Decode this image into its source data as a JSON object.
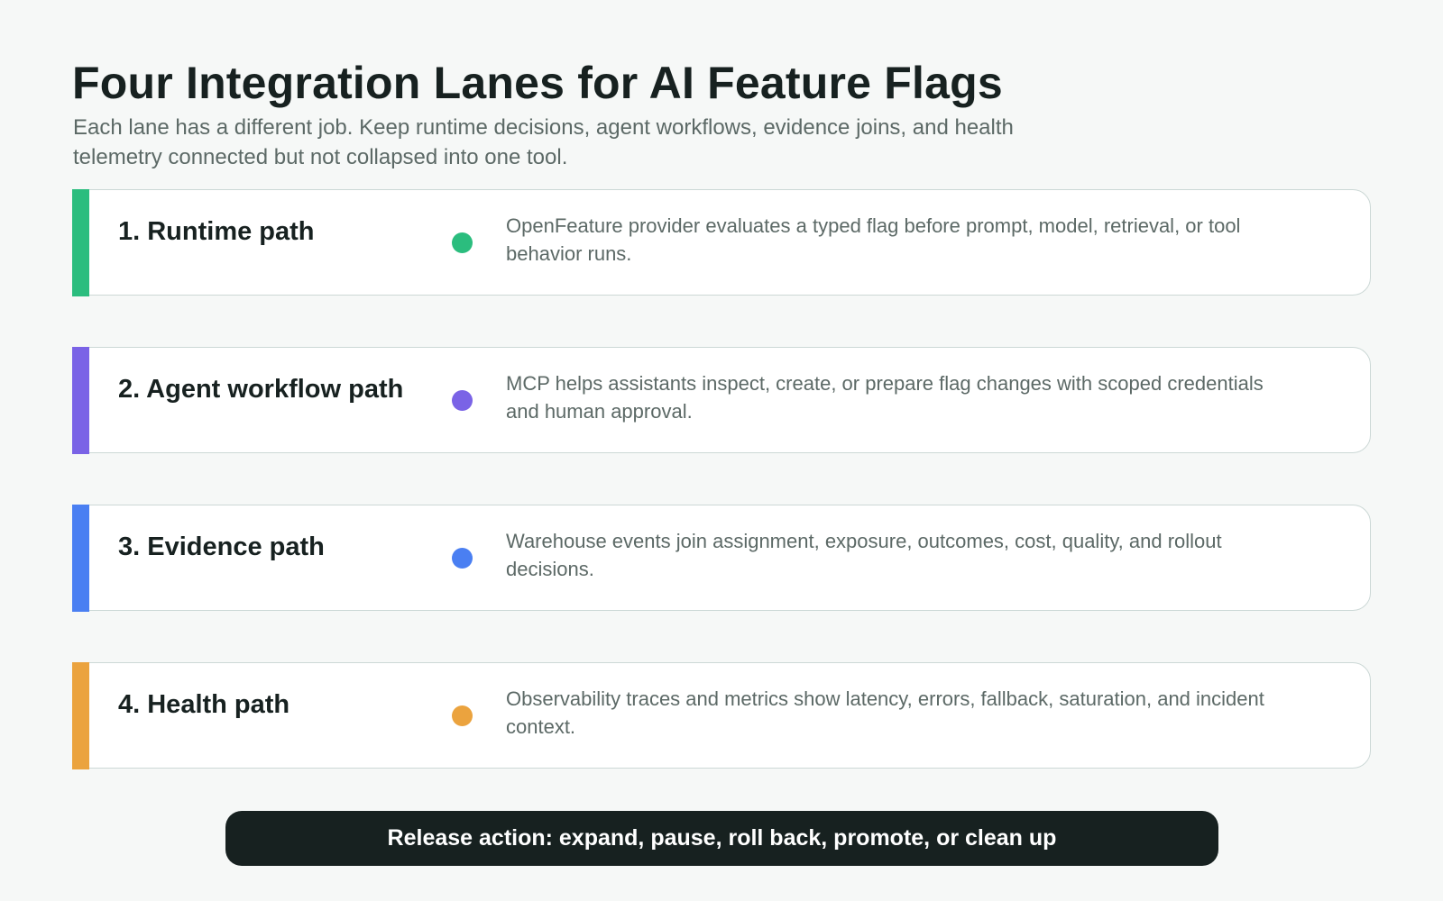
{
  "header": {
    "title": "Four Integration Lanes for AI Feature Flags",
    "subtitle": "Each lane has a different job. Keep runtime decisions, agent workflows, evidence joins, and health telemetry connected but not collapsed into one tool."
  },
  "lanes": [
    {
      "title": "1. Runtime path",
      "description": "OpenFeature provider evaluates a typed flag before prompt, model, retrieval, or tool behavior runs.",
      "color": "#2bbd7e"
    },
    {
      "title": "2. Agent workflow path",
      "description": "MCP helps assistants inspect, create, or prepare flag changes with scoped credentials and human approval.",
      "color": "#7a63e6"
    },
    {
      "title": "3. Evidence path",
      "description": "Warehouse events join assignment, exposure, outcomes, cost, quality, and rollout decisions.",
      "color": "#4a7ff2"
    },
    {
      "title": "4. Health path",
      "description": "Observability traces and metrics show latency, errors, fallback, saturation, and incident context.",
      "color": "#eba33e"
    }
  ],
  "action": {
    "label": "Release action: expand, pause, roll back, promote, or clean up",
    "color": "#172120"
  }
}
